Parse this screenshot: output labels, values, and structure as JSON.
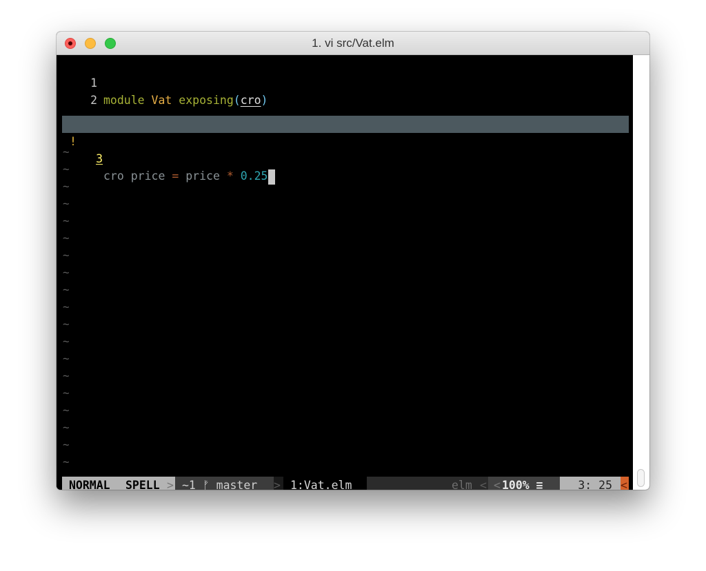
{
  "window": {
    "title": "1. vi src/Vat.elm"
  },
  "buffer": {
    "line1": {
      "number": "1",
      "kw_module": "module",
      "module_name": "Vat",
      "kw_exposing": "exposing",
      "paren_open": "(",
      "exposed": "cro",
      "paren_close": ")"
    },
    "line2": {
      "number": "2"
    },
    "line3": {
      "sign": "!",
      "number": "3",
      "name": "cro",
      "param": "price",
      "equals": "=",
      "rhs": "price",
      "op": "*",
      "number_literal": "0.25"
    },
    "empty_line_marker": "~"
  },
  "statusline": {
    "mode": "NORMAL",
    "spell": "SPELL",
    "sep_right": ">",
    "branch": "~1 ᚠ master",
    "file": "1:Vat.elm",
    "filetype": "elm",
    "sep_left": "<",
    "percent": "100% ≡",
    "position": "3: 25",
    "warning": "<"
  },
  "colors": {
    "keyword": "#a7b236",
    "module_name": "#e4ac45",
    "paren": "#6ec4ea",
    "current_line_bg": "#4c595f",
    "line_number_current": "#fff06a",
    "number_literal": "#2ea6b1",
    "warning_segment": "#d6612a"
  }
}
